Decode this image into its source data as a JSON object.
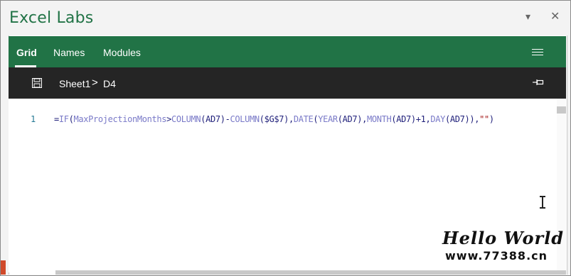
{
  "app": {
    "title": "Excel Labs"
  },
  "nav": {
    "tabs": [
      {
        "label": "Grid",
        "active": true
      },
      {
        "label": "Names",
        "active": false
      },
      {
        "label": "Modules",
        "active": false
      }
    ]
  },
  "toolbar": {
    "sheet": "Sheet1",
    "separator": ">",
    "cell": "D4"
  },
  "editor": {
    "line_number": "1",
    "formula": "=IF(MaxProjectionMonths>COLUMN(AD7)-COLUMN($G$7),DATE(YEAR(AD7),MONTH(AD7)+1,DAY(AD7)),\"\")"
  },
  "watermark": {
    "line1": "Hello World",
    "line2": "www.77388.cn"
  },
  "colors": {
    "accent": "#217346",
    "toolbar": "#252525",
    "title": "#217346"
  },
  "icons": [
    "dropdown-icon",
    "close-icon",
    "hamburger-menu-icon",
    "save-icon",
    "pin-icon",
    "text-cursor-icon"
  ]
}
